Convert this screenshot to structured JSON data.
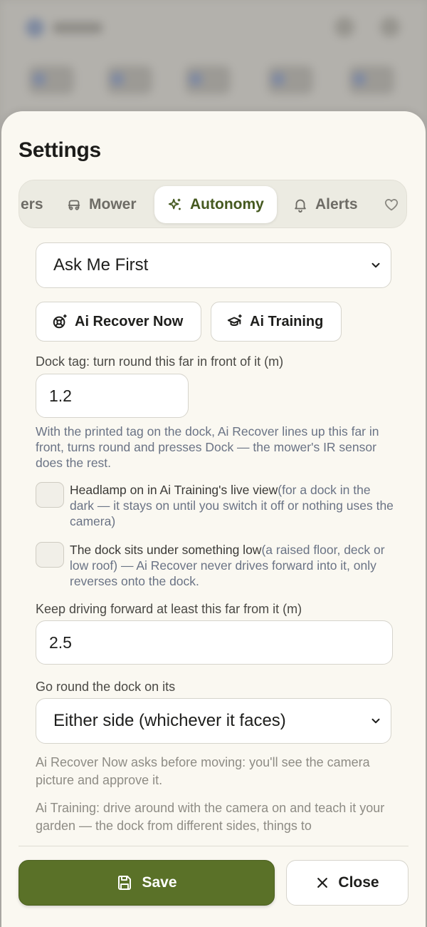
{
  "dialog": {
    "title": "Settings"
  },
  "tabs": [
    {
      "label": "ers",
      "icon": "partial-tab"
    },
    {
      "label": "Mower",
      "icon": "mower-icon"
    },
    {
      "label": "Autonomy",
      "icon": "sparkle-icon",
      "active": true
    },
    {
      "label": "Alerts",
      "icon": "bell-icon"
    },
    {
      "label": "",
      "icon": "heart-icon"
    }
  ],
  "autonomy": {
    "mode_select": {
      "value": "Ask Me First"
    },
    "ai_recover_button": {
      "label": "Ai Recover Now",
      "icon": "lifebuoy-icon"
    },
    "ai_training_button": {
      "label": "Ai Training",
      "icon": "graduation-cap-icon"
    },
    "dock_tag": {
      "label": "Dock tag: turn round this far in front of it (m)",
      "value": "1.2",
      "help": "With the printed tag on the dock, Ai Recover lines up this far in front, turns round and presses Dock — the mower's IR sensor does the rest."
    },
    "headlamp_checkbox": {
      "checked": false,
      "label": "Headlamp on in Ai Training's live view",
      "note": "(for a dock in the dark — it stays on until you switch it off or nothing uses the camera)"
    },
    "low_dock_checkbox": {
      "checked": false,
      "label": "The dock sits under something low",
      "note": "(a raised floor, deck or low roof) — Ai Recover never drives forward into it, only reverses onto the dock."
    },
    "keep_forward": {
      "label": "Keep driving forward at least this far from it (m)",
      "value": "2.5"
    },
    "dock_side": {
      "label": "Go round the dock on its",
      "value": "Either side (whichever it faces)"
    },
    "recover_info": "Ai Recover Now asks before moving: you'll see the camera picture and approve it.",
    "training_info": "Ai Training: drive around with the camera on and teach it your garden — the dock from different sides, things to"
  },
  "footer": {
    "save_label": "Save",
    "close_label": "Close"
  },
  "colors": {
    "accent": "#5a7128",
    "active_tab_text": "#45591f",
    "sheet_bg": "#faf8f1",
    "help_text": "#6a7385"
  }
}
